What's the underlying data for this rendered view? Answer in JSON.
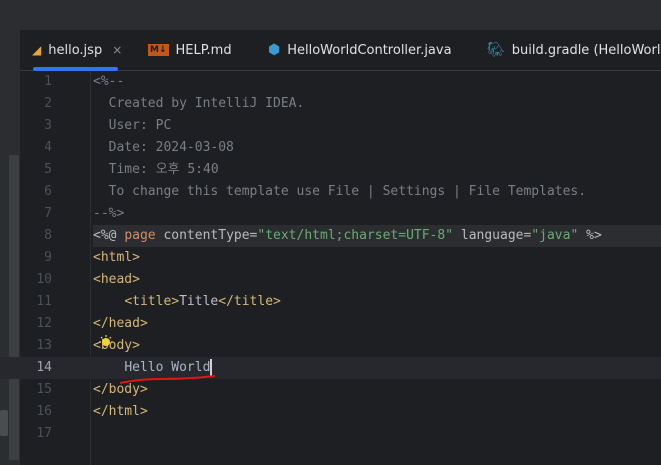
{
  "tabs": [
    {
      "label": "hello.jsp",
      "icon": "jsp-file-icon",
      "icon_color": "#e8a33d",
      "active": true,
      "close": "×"
    },
    {
      "label": "HELP.md",
      "icon": "markdown-file-icon",
      "icon_color": "#c2571a",
      "badge": "M↓"
    },
    {
      "label": "HelloWorldController.java",
      "icon": "java-class-icon",
      "icon_color": "#3d9ad1"
    },
    {
      "label": "build.gradle (HelloWorld)",
      "icon": "gradle-elephant-icon",
      "icon_color": "#2f8eaa"
    }
  ],
  "editor": {
    "current_line": 14,
    "lines": [
      {
        "n": "1",
        "tokens": [
          [
            "<%--",
            "cm"
          ]
        ]
      },
      {
        "n": "2",
        "tokens": [
          [
            "  Created by IntelliJ IDEA.",
            "cm"
          ]
        ]
      },
      {
        "n": "3",
        "tokens": [
          [
            "  User: PC",
            "cm"
          ]
        ]
      },
      {
        "n": "4",
        "tokens": [
          [
            "  Date: 2024-03-08",
            "cm"
          ]
        ]
      },
      {
        "n": "5",
        "tokens": [
          [
            "  Time: 오후 5:40",
            "cm"
          ]
        ]
      },
      {
        "n": "6",
        "tokens": [
          [
            "  To change this template use File | Settings | File Templates.",
            "cm"
          ]
        ]
      },
      {
        "n": "7",
        "tokens": [
          [
            "--%>",
            "cm"
          ]
        ]
      },
      {
        "n": "8",
        "directive": true,
        "tokens": [
          [
            "<%@ ",
            "txt"
          ],
          [
            "page",
            "kw"
          ],
          [
            " contentType=",
            "attr"
          ],
          [
            "\"text/html;charset=UTF-8\"",
            "str"
          ],
          [
            " language=",
            "attr"
          ],
          [
            "\"java\"",
            "str"
          ],
          [
            " %>",
            "txt"
          ]
        ]
      },
      {
        "n": "9",
        "tokens": [
          [
            "<html>",
            "tag"
          ]
        ]
      },
      {
        "n": "10",
        "tokens": [
          [
            "<head>",
            "tag"
          ]
        ]
      },
      {
        "n": "11",
        "tokens": [
          [
            "    ",
            "txt"
          ],
          [
            "<title>",
            "tag"
          ],
          [
            "Title",
            "txt"
          ],
          [
            "</title>",
            "tag"
          ]
        ]
      },
      {
        "n": "12",
        "tokens": [
          [
            "</head>",
            "tag"
          ]
        ]
      },
      {
        "n": "13",
        "tokens": [
          [
            "<body>",
            "tag"
          ]
        ]
      },
      {
        "n": "14",
        "tokens": [
          [
            "    ",
            "txt"
          ],
          [
            "Hello World",
            "hw"
          ]
        ]
      },
      {
        "n": "15",
        "tokens": [
          [
            "</body>",
            "tag"
          ]
        ]
      },
      {
        "n": "16",
        "tokens": [
          [
            "</html>",
            "tag"
          ]
        ]
      },
      {
        "n": "17",
        "tokens": []
      }
    ]
  }
}
